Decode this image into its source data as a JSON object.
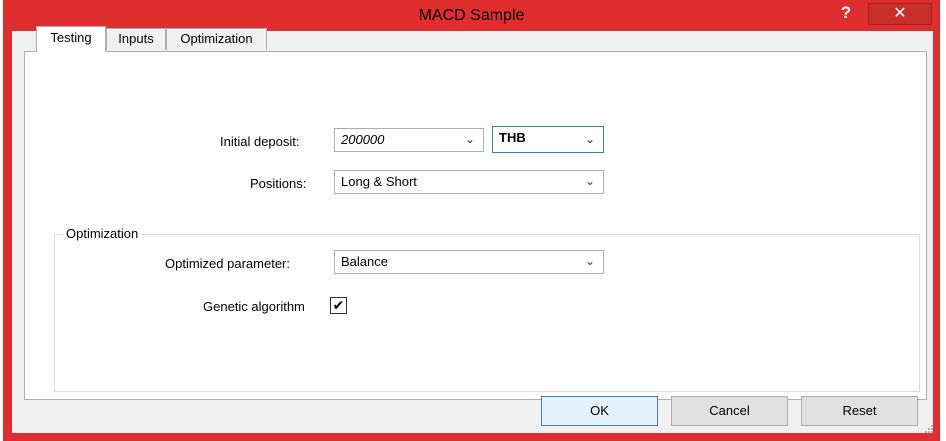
{
  "window": {
    "title": "MACD Sample",
    "help_label": "?",
    "close_label": "✕"
  },
  "tabs": [
    {
      "label": "Testing",
      "active": true
    },
    {
      "label": "Inputs",
      "active": false
    },
    {
      "label": "Optimization",
      "active": false
    }
  ],
  "testing": {
    "initial_deposit_label": "Initial deposit:",
    "initial_deposit_value": "200000",
    "currency_value": "THB",
    "positions_label": "Positions:",
    "positions_value": "Long & Short"
  },
  "optimization_group": {
    "title": "Optimization",
    "optimized_parameter_label": "Optimized parameter:",
    "optimized_parameter_value": "Balance",
    "genetic_algorithm_label": "Genetic algorithm",
    "genetic_algorithm_checked": true,
    "check_mark": "✔"
  },
  "dropdown_arrow": "⌄",
  "buttons": {
    "ok": "OK",
    "cancel": "Cancel",
    "reset": "Reset"
  },
  "icons": {
    "help": "question-icon",
    "close": "close-icon",
    "dropdown": "chevron-down-icon",
    "check": "checkmark-icon",
    "grip": "resize-grip-icon"
  },
  "colors": {
    "title_bar": "#e02d2d",
    "close_button": "#c7302a",
    "dialog_background": "#f0f0f0",
    "focus_border": "#3c7fb1"
  }
}
